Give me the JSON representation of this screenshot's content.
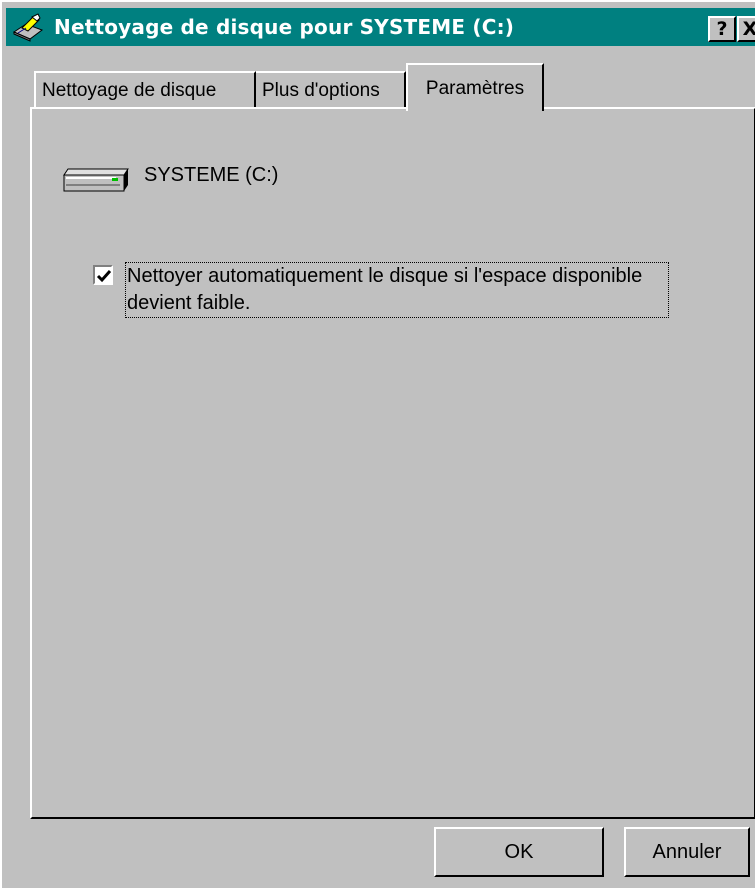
{
  "window": {
    "title": "Nettoyage de disque pour SYSTEME (C:)",
    "help_label": "?",
    "close_label": "X"
  },
  "tabs": [
    {
      "label": "Nettoyage de disque",
      "selected": false
    },
    {
      "label": "Plus d'options",
      "selected": false
    },
    {
      "label": "Paramètres",
      "selected": true
    }
  ],
  "settings": {
    "drive_label": "SYSTEME (C:)",
    "auto_clean_checked": true,
    "auto_clean_label": "Nettoyer automatiquement le disque si l'espace disponible devient faible."
  },
  "buttons": {
    "ok": "OK",
    "cancel": "Annuler"
  },
  "colors": {
    "titlebar": "#008080",
    "face": "#c0c0c0"
  }
}
